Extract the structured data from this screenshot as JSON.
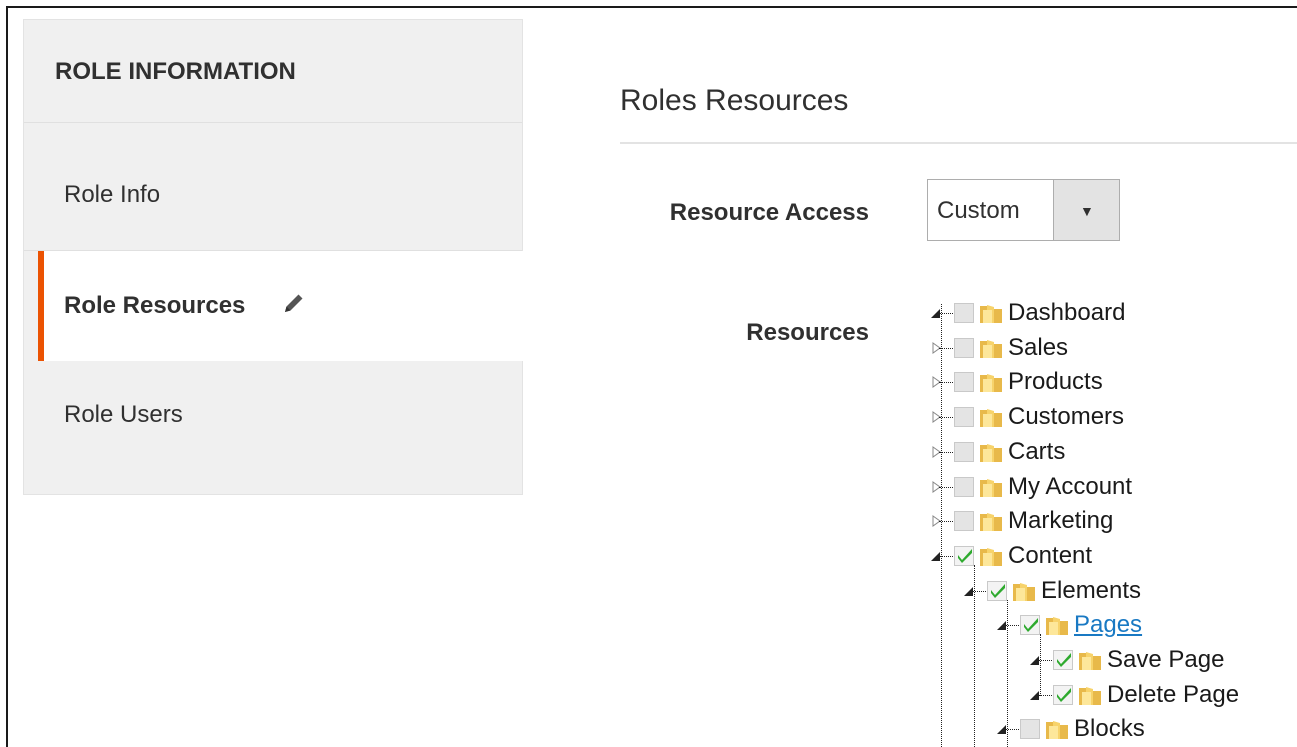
{
  "sidebar": {
    "title": "ROLE INFORMATION",
    "tabs": [
      "Role Info",
      "Role Resources",
      "Role Users"
    ],
    "active_tab": "Role Resources",
    "accent_color": "#eb5202"
  },
  "main": {
    "title": "Roles Resources",
    "resource_access": {
      "label": "Resource Access",
      "value": "Custom"
    },
    "resources_label": "Resources"
  },
  "tree": [
    {
      "label": "Dashboard",
      "checked": false,
      "expanded": true
    },
    {
      "label": "Sales",
      "checked": false,
      "expanded": false
    },
    {
      "label": "Products",
      "checked": false,
      "expanded": false
    },
    {
      "label": "Customers",
      "checked": false,
      "expanded": false
    },
    {
      "label": "Carts",
      "checked": false,
      "expanded": false
    },
    {
      "label": "My Account",
      "checked": false,
      "expanded": false
    },
    {
      "label": "Marketing",
      "checked": false,
      "expanded": false
    },
    {
      "label": "Content",
      "checked": true,
      "expanded": true
    },
    {
      "label": "Elements",
      "checked": true,
      "expanded": true
    },
    {
      "label": "Pages",
      "checked": true,
      "expanded": true,
      "link": true
    },
    {
      "label": "Save Page",
      "checked": true,
      "expanded": true
    },
    {
      "label": "Delete Page",
      "checked": true,
      "expanded": true
    },
    {
      "label": "Blocks",
      "checked": false,
      "expanded": true
    }
  ],
  "icons": [
    "pencil-icon",
    "dropdown-arrow-icon",
    "folder-icon",
    "checkmark-icon",
    "expander-icon"
  ]
}
